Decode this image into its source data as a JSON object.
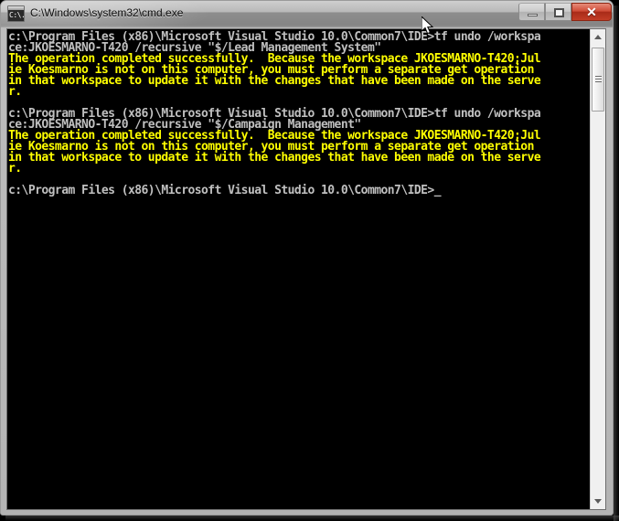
{
  "window": {
    "title": "C:\\Windows\\system32\\cmd.exe",
    "icon_name": "cmd-console-icon",
    "icon_glyph": "C:\\.",
    "state": "inactive",
    "buttons": {
      "minimize_label": "–",
      "maximize_label": "□",
      "close_label": "✕"
    }
  },
  "console": {
    "background_color": "#000000",
    "default_text_color": "#c0c0c0",
    "warning_text_color": "#ffff00",
    "columns": 80,
    "lines": [
      {
        "color": "default",
        "text": "c:\\Program Files (x86)\\Microsoft Visual Studio 10.0\\Common7\\IDE>tf undo /workspa"
      },
      {
        "color": "default",
        "text": "ce:JKOESMARNO-T420 /recursive \"$/Lead Management System\""
      },
      {
        "color": "warn",
        "text": "The operation completed successfully.  Because the workspace JKOESMARNO-T420;Jul"
      },
      {
        "color": "warn",
        "text": "ie Koesmarno is not on this computer, you must perform a separate get operation"
      },
      {
        "color": "warn",
        "text": "in that workspace to update it with the changes that have been made on the serve"
      },
      {
        "color": "warn",
        "text": "r."
      },
      {
        "color": "default",
        "text": ""
      },
      {
        "color": "default",
        "text": "c:\\Program Files (x86)\\Microsoft Visual Studio 10.0\\Common7\\IDE>tf undo /workspa"
      },
      {
        "color": "default",
        "text": "ce:JKOESMARNO-T420 /recursive \"$/Campaign Management\""
      },
      {
        "color": "warn",
        "text": "The operation completed successfully.  Because the workspace JKOESMARNO-T420;Jul"
      },
      {
        "color": "warn",
        "text": "ie Koesmarno is not on this computer, you must perform a separate get operation"
      },
      {
        "color": "warn",
        "text": "in that workspace to update it with the changes that have been made on the serve"
      },
      {
        "color": "warn",
        "text": "r."
      },
      {
        "color": "default",
        "text": ""
      },
      {
        "color": "default",
        "text": "c:\\Program Files (x86)\\Microsoft Visual Studio 10.0\\Common7\\IDE>_"
      }
    ]
  },
  "scrollbar": {
    "up_arrow_name": "scroll-up-arrow",
    "down_arrow_name": "scroll-down-arrow",
    "thumb_name": "scroll-thumb"
  }
}
